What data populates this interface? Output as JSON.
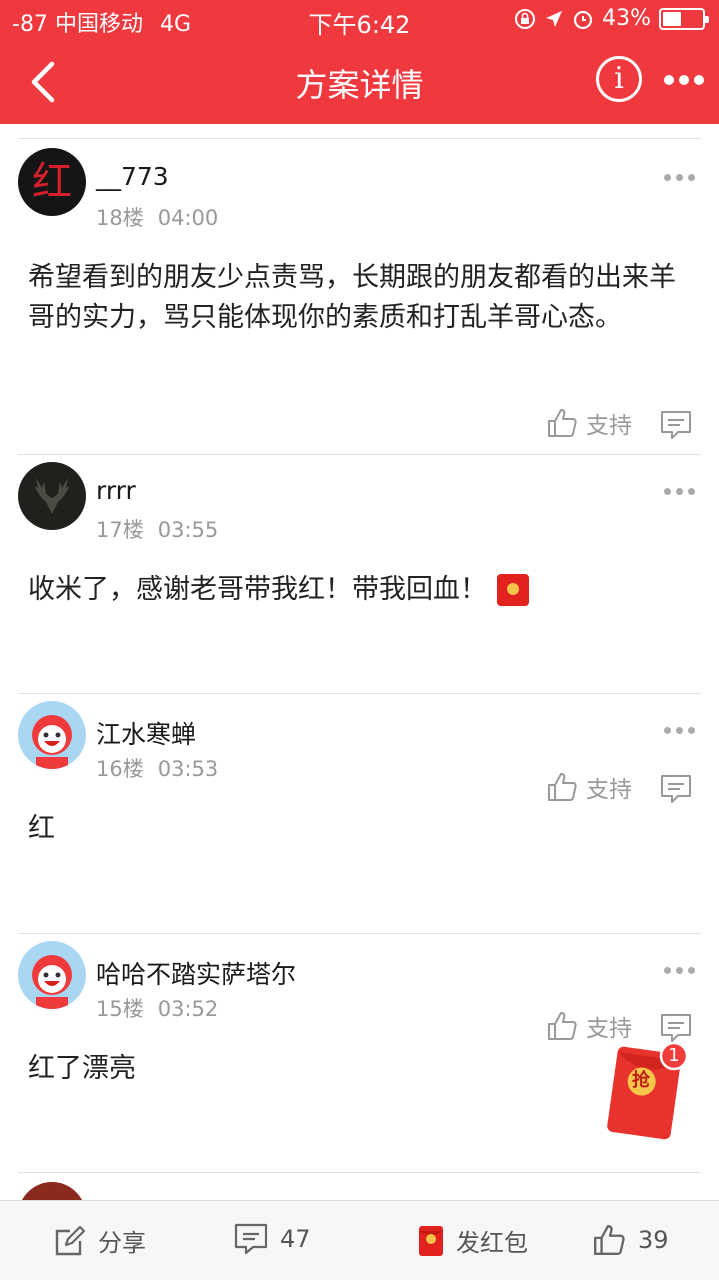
{
  "status": {
    "signal": "-87",
    "carrier": "中国移动",
    "network": "4G",
    "time": "下午6:42",
    "battery": "43%"
  },
  "nav": {
    "title": "方案详情"
  },
  "comments": [
    {
      "user": "__773",
      "floor": "18楼",
      "time": "04:00",
      "text": "希望看到的朋友少点责骂，长期跟的朋友都看的出来羊哥的实力，骂只能体现你的素质和打乱羊哥心态。",
      "support": "支持",
      "avatar_text": "红"
    },
    {
      "user": "rrrr",
      "floor": "17楼",
      "time": "03:55",
      "text": "收米了，感谢老哥带我红！带我回血！",
      "support": "支持"
    },
    {
      "user": "江水寒蝉",
      "floor": "16楼",
      "time": "03:53",
      "text": "红",
      "support": "支持"
    },
    {
      "user": "哈哈不踏实萨塔尔",
      "floor": "15楼",
      "time": "03:52",
      "text": "红了漂亮",
      "support": "支持"
    }
  ],
  "redpacket": {
    "badge": "1",
    "label": "抢"
  },
  "bottom": {
    "share": "分享",
    "comments": "47",
    "redpacket": "发红包",
    "likes": "39"
  }
}
